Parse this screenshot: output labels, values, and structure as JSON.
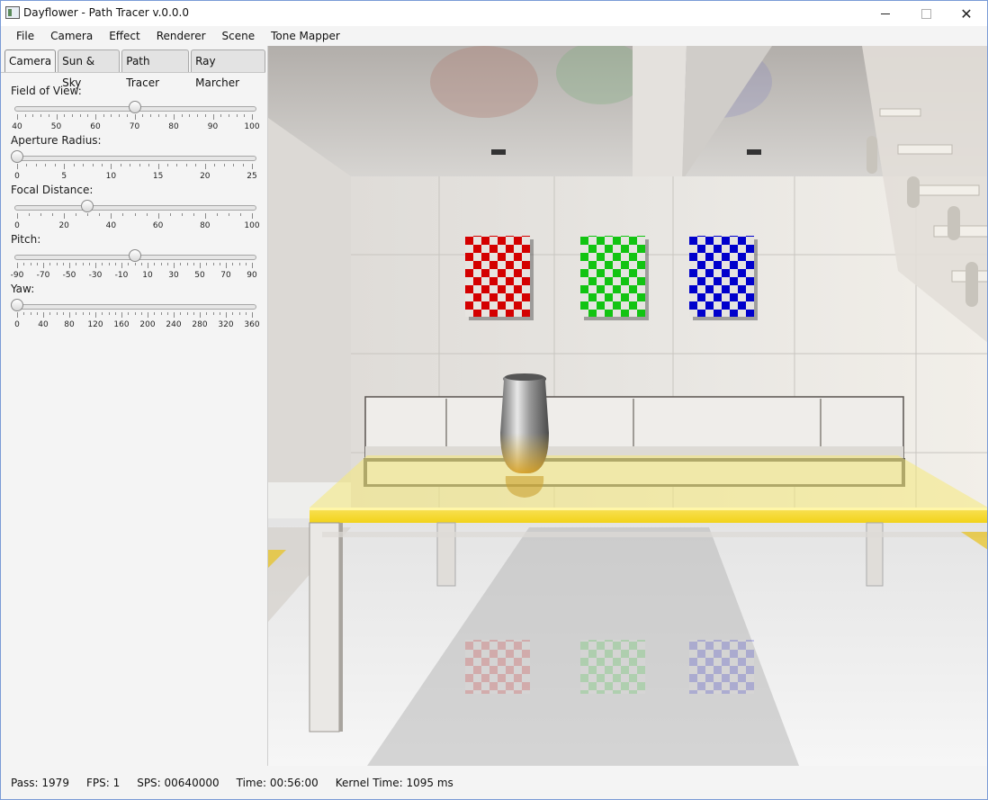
{
  "window": {
    "title": "Dayflower - Path Tracer v.0.0.0",
    "minimize": "—",
    "maximize": "□",
    "close": "✕"
  },
  "menu": [
    "File",
    "Camera",
    "Effect",
    "Renderer",
    "Scene",
    "Tone Mapper"
  ],
  "tabs": [
    {
      "label": "Camera",
      "active": true
    },
    {
      "label": "Sun & Sky",
      "active": false
    },
    {
      "label": "Path Tracer",
      "active": false
    },
    {
      "label": "Ray Marcher",
      "active": false
    }
  ],
  "sliders": [
    {
      "label": "Field of View:",
      "min": 40,
      "max": 100,
      "value": 70,
      "ticks": [
        "40",
        "50",
        "60",
        "70",
        "80",
        "90",
        "100"
      ],
      "minor_per_major": 5
    },
    {
      "label": "Aperture Radius:",
      "min": 0,
      "max": 25,
      "value": 0,
      "ticks": [
        "0",
        "5",
        "10",
        "15",
        "20",
        "25"
      ],
      "minor_per_major": 5
    },
    {
      "label": "Focal Distance:",
      "min": 0,
      "max": 100,
      "value": 30,
      "ticks": [
        "0",
        "20",
        "40",
        "60",
        "80",
        "100"
      ],
      "minor_per_major": 4
    },
    {
      "label": "Pitch:",
      "min": -90,
      "max": 90,
      "value": 0,
      "ticks": [
        "-90",
        "-70",
        "-50",
        "-30",
        "-10",
        "10",
        "30",
        "50",
        "70",
        "90"
      ],
      "minor_per_major": 4
    },
    {
      "label": "Yaw:",
      "min": 0,
      "max": 360,
      "value": 0,
      "ticks": [
        "0",
        "40",
        "80",
        "120",
        "160",
        "200",
        "240",
        "280",
        "320",
        "360"
      ],
      "minor_per_major": 4
    }
  ],
  "status": {
    "pass": "Pass: 1979",
    "fps": "FPS: 1",
    "sps": "SPS: 00640000",
    "time": "Time: 00:56:00",
    "kernel": "Kernel Time: 1095 ms"
  },
  "colors": {
    "tabletop": "#f2d31a",
    "red_checker": "#d40000",
    "green_checker": "#12c412",
    "blue_checker": "#0000cc"
  }
}
